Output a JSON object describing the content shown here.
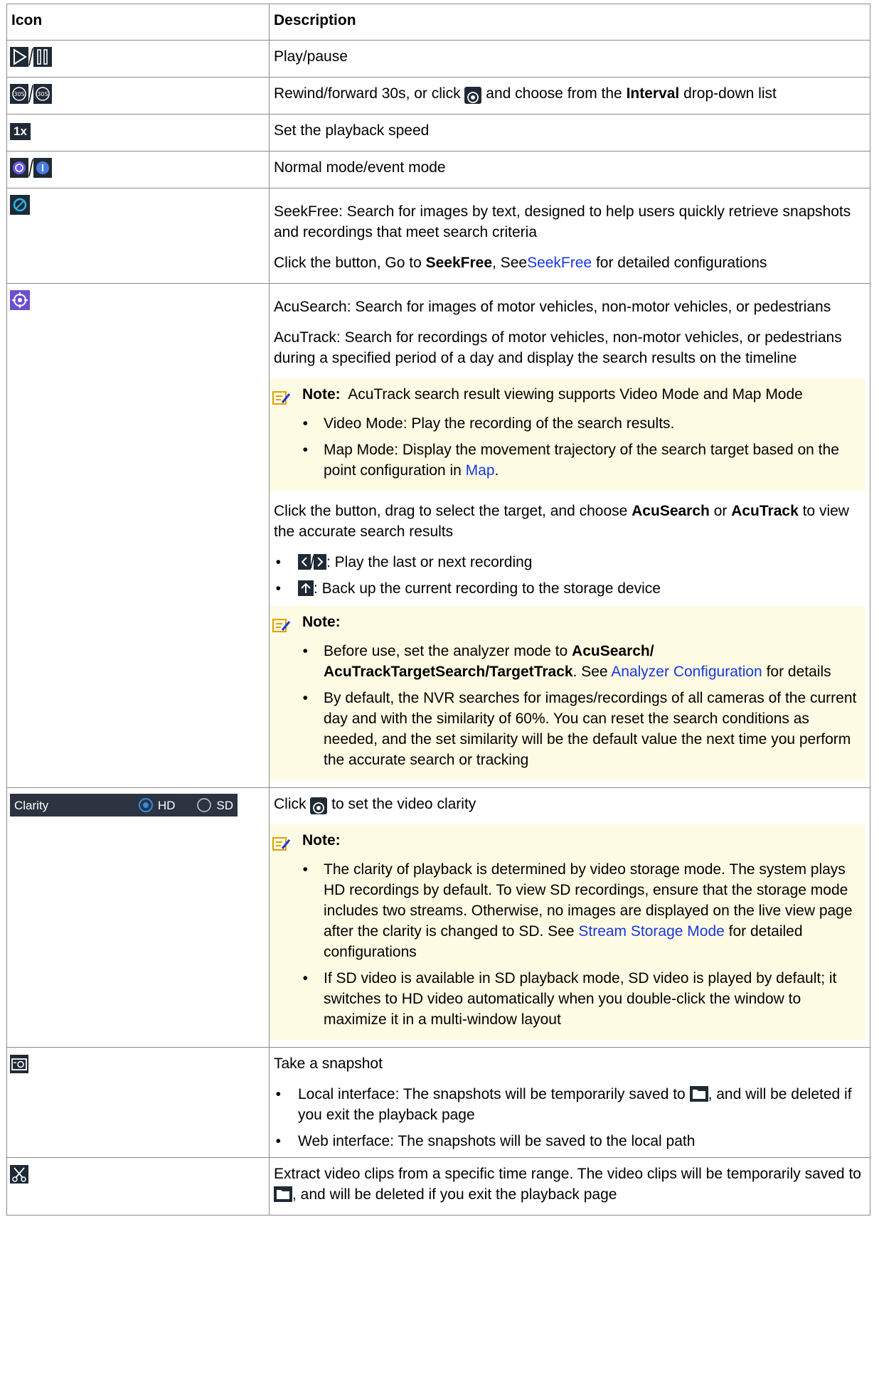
{
  "header": {
    "col_icon": "Icon",
    "col_desc": "Description"
  },
  "rows": {
    "play": {
      "icon": "play-pause-icon",
      "desc": "Play/pause"
    },
    "rewind": {
      "icon": "rewind-forward-30s-icon",
      "desc_a": "Rewind/forward 30s, or click ",
      "desc_b": " and choose from the ",
      "desc_bold": "Interval",
      "desc_c": " drop-down list"
    },
    "speed": {
      "icon_text": "1x",
      "desc": "Set the playback speed"
    },
    "mode": {
      "icon": "normal-event-mode-icon",
      "desc": "Normal mode/event mode"
    },
    "seekfree": {
      "icon": "seekfree-icon",
      "p1": "SeekFree: Search for images by text, designed to help users quickly retrieve snapshots and recordings that meet search criteria",
      "p2_a": "Click the button, Go to ",
      "p2_bold": "SeekFree",
      "p2_b": ", See",
      "p2_link": "SeekFree",
      "p2_c": " for detailed configurations"
    },
    "acu": {
      "icon": "acusearch-icon",
      "p1": "AcuSearch: Search for images of motor vehicles, non-motor vehicles, or pedestrians",
      "p2": "AcuTrack: Search for recordings of motor vehicles, non-motor vehicles, or pedestrians during a specified period of a day and display the search results on the timeline",
      "note1_label": "Note:",
      "note1_text": "AcuTrack search result viewing supports Video Mode and Map Mode",
      "note1_b1": "Video Mode: Play the recording of the search results.",
      "note1_b2_a": "Map Mode: Display the movement trajectory of the search target based on the point configuration in ",
      "note1_b2_link": "Map",
      "note1_b2_c": ".",
      "p3_a": "Click the button, drag to select the target, and choose ",
      "p3_bold1": "AcuSearch",
      "p3_b": " or ",
      "p3_bold2": "AcuTrack",
      "p3_c": " to view the accurate search results",
      "b1": ": Play the last or next recording",
      "b2": ": Back up the current recording to the storage device",
      "note2_label": "Note:",
      "note2_b1_a": "Before use, set the analyzer mode to ",
      "note2_b1_bold": "AcuSearch/ AcuTrackTargetSearch/TargetTrack",
      "note2_b1_b": ". See ",
      "note2_b1_link": "Analyzer Configuration",
      "note2_b1_c": " for details",
      "note2_b2": "By default, the NVR searches for images/recordings of all cameras of the current day and with the similarity of 60%. You can reset the search conditions as needed, and the set similarity will be the default value the next time you perform the accurate search or tracking"
    },
    "clarity": {
      "bar_label": "Clarity",
      "opt_hd": "HD",
      "opt_sd": "SD",
      "p1_a": "Click ",
      "p1_b": " to set the video clarity",
      "note_label": "Note:",
      "b1_a": "The clarity of playback is determined by video storage mode. The system plays HD recordings by default. To view SD recordings, ensure that the storage mode includes two streams. Otherwise, no images are displayed on the live view page after the clarity is changed to SD. See ",
      "b1_link": "Stream Storage Mode",
      "b1_c": " for detailed configurations",
      "b2": "If SD video is available in SD playback mode, SD video is played by default; it switches to HD video automatically when you double-click the window to maximize it in a multi-window layout"
    },
    "snapshot": {
      "icon": "snapshot-icon",
      "p1": "Take a snapshot",
      "b1_a": "Local interface: The snapshots will be temporarily saved to ",
      "b1_b": ", and will be deleted if you exit the playback page",
      "b2": "Web interface: The snapshots will be saved to the local path"
    },
    "clip": {
      "icon": "scissors-icon",
      "p1_a": "Extract video clips from a specific time range. The video clips will be temporarily saved to ",
      "p1_b": ", and will be deleted if you exit the playback page"
    }
  },
  "colors": {
    "link": "#1a37e0",
    "note_bg": "#fdfbe3",
    "icon_dark": "#1f2a36",
    "clarity_bar": "#2b3440",
    "radio_blue": "#2e8de6"
  }
}
